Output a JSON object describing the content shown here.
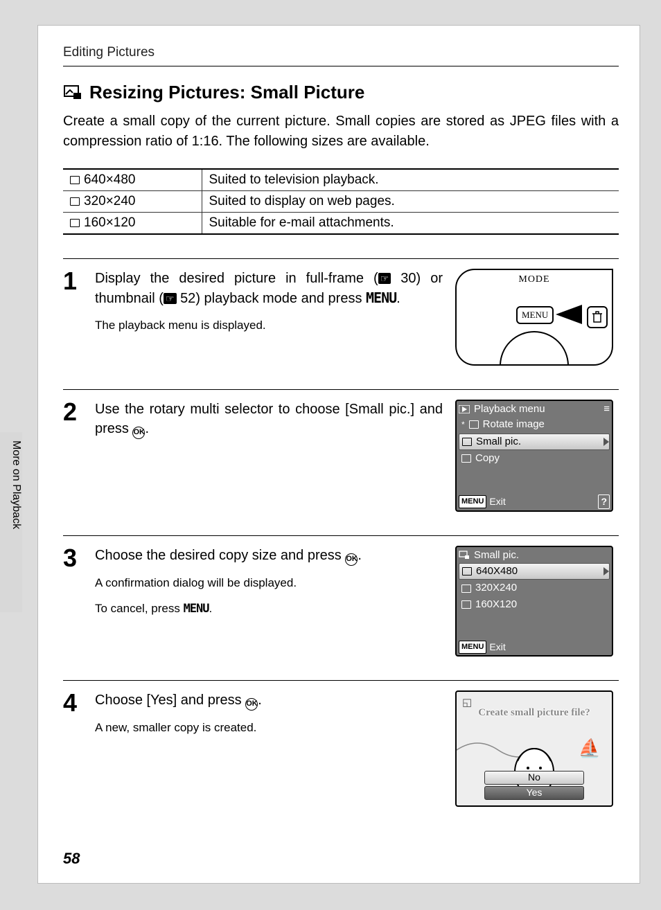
{
  "breadcrumb": "Editing Pictures",
  "section_title": "Resizing Pictures: Small Picture",
  "intro": "Create a small copy of the current picture. Small copies are stored as JPEG files with a compression ratio of 1:16. The following sizes are available.",
  "sizes_table": [
    {
      "size": "640×480",
      "desc": "Suited to television playback."
    },
    {
      "size": "320×240",
      "desc": "Suited to display on web pages."
    },
    {
      "size": "160×120",
      "desc": "Suitable for e-mail attachments."
    }
  ],
  "steps": [
    {
      "num": "1",
      "main_prefix": "Display the desired picture in full-frame (",
      "ref1": "30",
      "main_mid": ") or thumbnail (",
      "ref2": "52",
      "main_suffix": ") playback mode and press ",
      "menu_glyph": "MENU",
      "main_end": ".",
      "sub": "The playback menu is displayed."
    },
    {
      "num": "2",
      "main_prefix": "Use the rotary multi selector to choose [Small pic.] and press ",
      "ok_glyph": "OK",
      "main_end": ".",
      "sub": ""
    },
    {
      "num": "3",
      "main_prefix": "Choose the desired copy size and press ",
      "ok_glyph": "OK",
      "main_end": ".",
      "sub1": "A confirmation dialog will be displayed.",
      "sub2_prefix": "To cancel, press ",
      "sub2_menu_glyph": "MENU",
      "sub2_end": "."
    },
    {
      "num": "4",
      "main_prefix": "Choose [Yes] and press ",
      "ok_glyph": "OK",
      "main_end": ".",
      "sub": "A new, smaller copy is created."
    }
  ],
  "camera_illus": {
    "mode_label": "MODE",
    "menu_button": "MENU"
  },
  "lcd_playback": {
    "header": "Playback menu",
    "items": [
      {
        "label": "Rotate image",
        "selected": false,
        "prefix": "*"
      },
      {
        "label": "Small pic.",
        "selected": true
      },
      {
        "label": "Copy",
        "selected": false
      }
    ],
    "footer_menu": "MENU",
    "footer_exit": "Exit",
    "footer_help": "?"
  },
  "lcd_smallpic": {
    "header": "Small pic.",
    "items": [
      {
        "label": "640X480",
        "selected": true
      },
      {
        "label": "320X240",
        "selected": false
      },
      {
        "label": "160X120",
        "selected": false
      }
    ],
    "footer_menu": "MENU",
    "footer_exit": "Exit"
  },
  "lcd_confirm": {
    "prompt": "Create small picture file?",
    "no": "No",
    "yes": "Yes"
  },
  "side_tab": "More on Playback",
  "page_number": "58"
}
